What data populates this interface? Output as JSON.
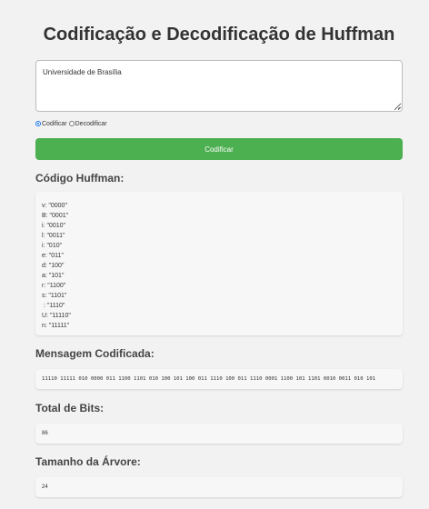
{
  "title": "Codificação e Decodificação de Huffman",
  "input": {
    "value": "Universidade de Brasília",
    "placeholder": ""
  },
  "modes": [
    {
      "label": "Codificar",
      "checked": true
    },
    {
      "label": "Decodificar",
      "checked": false
    }
  ],
  "action_button": "Codificar",
  "huffman_section": {
    "title": "Código Huffman:",
    "codes": [
      "v: \"0000\"",
      "B: \"0001\"",
      "i: \"0010\"",
      "l: \"0011\"",
      "i: \"010\"",
      "e: \"011\"",
      "d: \"100\"",
      "a: \"101\"",
      "r: \"1100\"",
      "s: \"1101\"",
      " : \"1110\"",
      "U: \"11110\"",
      "n: \"11111\""
    ]
  },
  "encoded_section": {
    "title": "Mensagem Codificada:",
    "value": "11110 11111 010 0000 011 1100 1101 010 100 101 100 011 1110 100 011 1110 0001 1100 101 1101 0010 0011 010 101"
  },
  "bits_section": {
    "title": "Total de Bits:",
    "value": "86"
  },
  "tree_section": {
    "title": "Tamanho da Árvore:",
    "value": "24"
  },
  "colors": {
    "background": "#f2f2f2",
    "button": "#4caf50",
    "button_text": "#ffffff",
    "panel": "#f7f7f7",
    "radio_accent": "#1a73e8"
  }
}
